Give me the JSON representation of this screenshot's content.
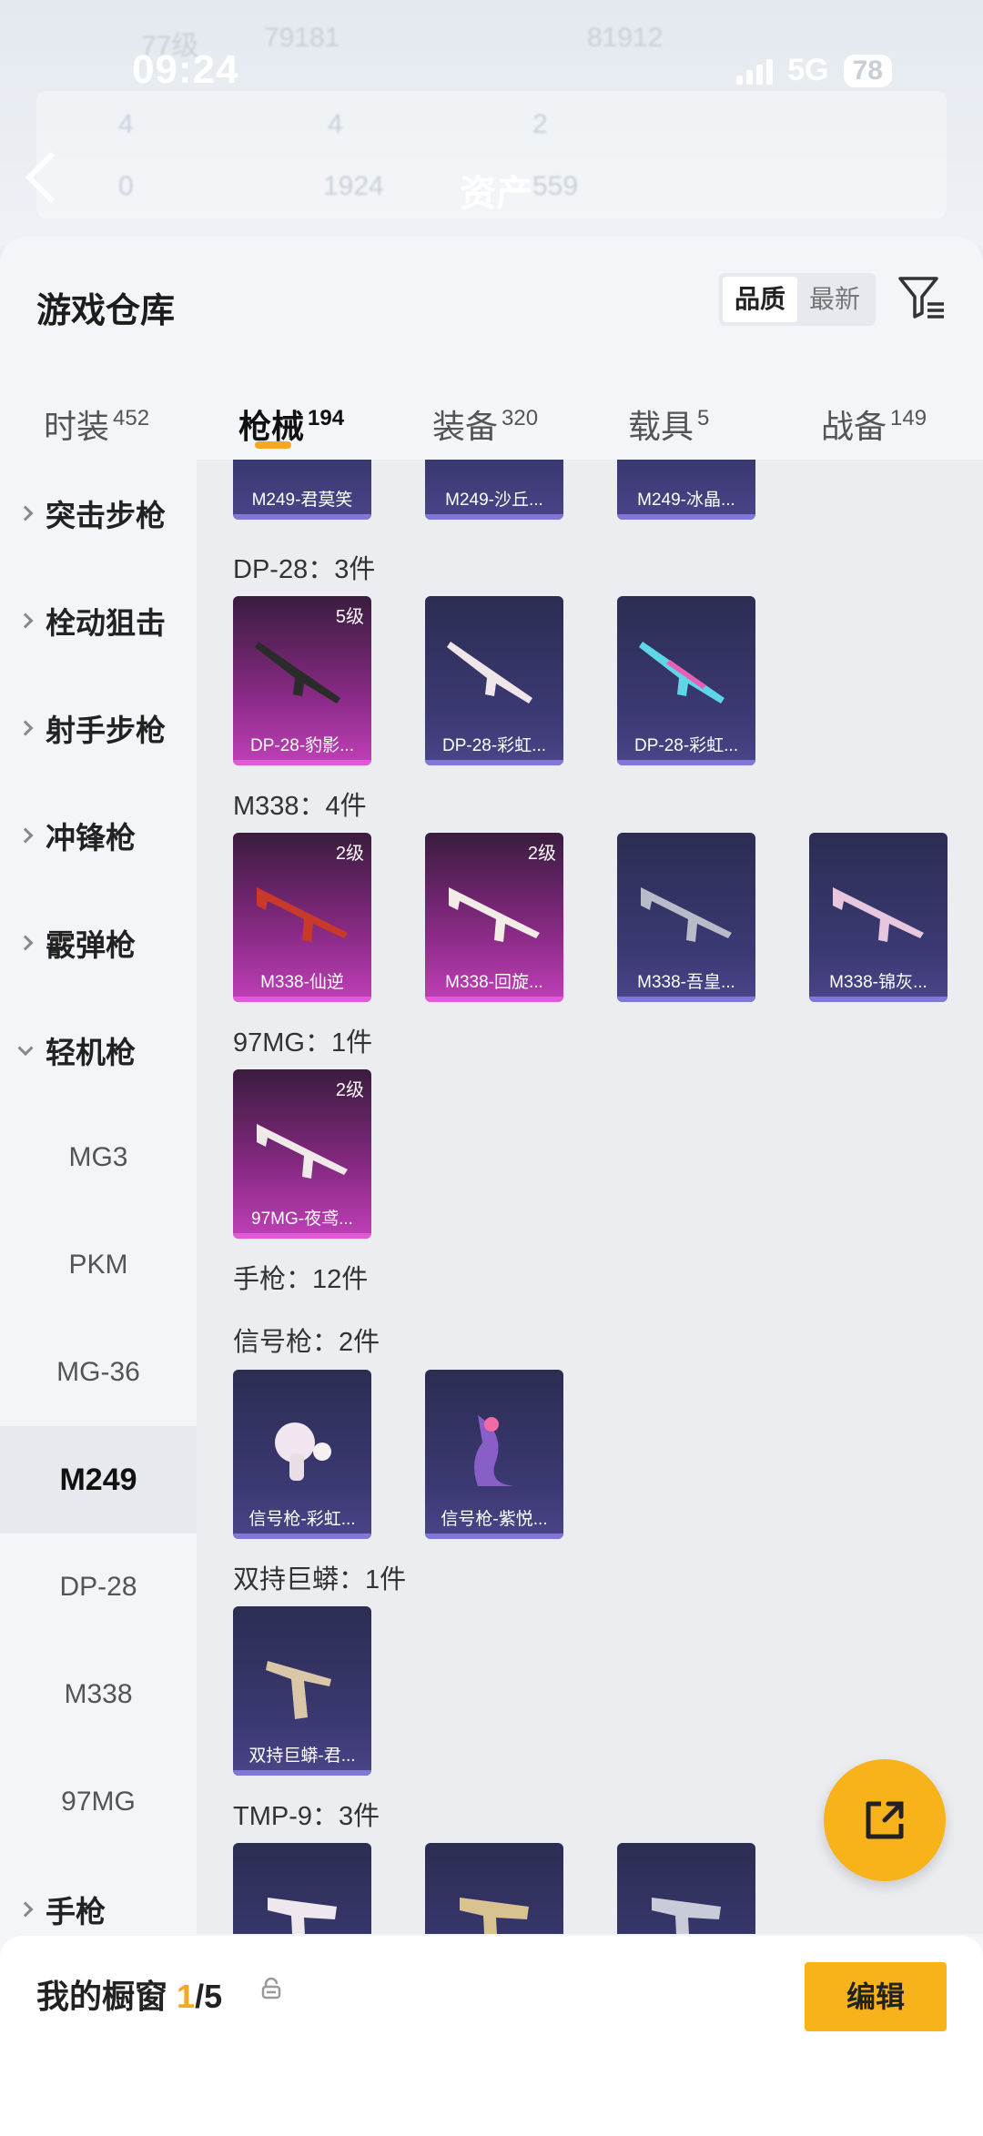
{
  "status": {
    "time": "09:24",
    "network": "5G",
    "battery": "78"
  },
  "background": {
    "asset_label": "资产",
    "ghost": [
      "77级",
      "79181",
      "81912",
      "4",
      "4",
      "2",
      "0",
      "1924",
      "559"
    ]
  },
  "header": {
    "title": "游戏仓库",
    "sort_quality": "品质",
    "sort_latest": "最新"
  },
  "tabs": [
    {
      "label": "时装",
      "count": "452"
    },
    {
      "label": "枪械",
      "count": "194"
    },
    {
      "label": "装备",
      "count": "320"
    },
    {
      "label": "载具",
      "count": "5"
    },
    {
      "label": "战备",
      "count": "149"
    }
  ],
  "sidebar": {
    "items": [
      "突击步枪",
      "栓动狙击",
      "射手步枪",
      "冲锋枪",
      "霰弹枪",
      "轻机枪",
      "MG3",
      "PKM",
      "MG-36",
      "M249",
      "DP-28",
      "M338",
      "97MG",
      "手枪"
    ]
  },
  "groups": [
    {
      "title": "DP-28：3件"
    },
    {
      "title": "M338：4件"
    },
    {
      "title": "97MG：1件"
    },
    {
      "title": "手枪：12件"
    },
    {
      "title": "信号枪：2件"
    },
    {
      "title": "双持巨蟒：1件"
    },
    {
      "title": "TMP-9：3件"
    }
  ],
  "cards": {
    "m249": [
      "M249-君莫笑",
      "M249-沙丘...",
      "M249-冰晶..."
    ],
    "dp28": [
      {
        "name": "DP-28-豹影...",
        "level": "5级"
      },
      {
        "name": "DP-28-彩虹...",
        "level": ""
      },
      {
        "name": "DP-28-彩虹...",
        "level": ""
      }
    ],
    "m338": [
      {
        "name": "M338-仙逆",
        "level": "2级"
      },
      {
        "name": "M338-回旋...",
        "level": "2级"
      },
      {
        "name": "M338-吾皇...",
        "level": ""
      },
      {
        "name": "M338-锦灰...",
        "level": ""
      }
    ],
    "mg97": [
      {
        "name": "97MG-夜鸢...",
        "level": "2级"
      }
    ],
    "flare": [
      "信号枪-彩虹...",
      "信号枪-紫悦..."
    ],
    "python": [
      "双持巨蟒-君..."
    ]
  },
  "footer": {
    "label": "我的橱窗",
    "current": "1",
    "total": "/5",
    "edit": "编辑"
  },
  "colors": {
    "accent": "#f8b21a",
    "rare_blue": "#3b3973",
    "rare_pink": "#c040b8"
  }
}
